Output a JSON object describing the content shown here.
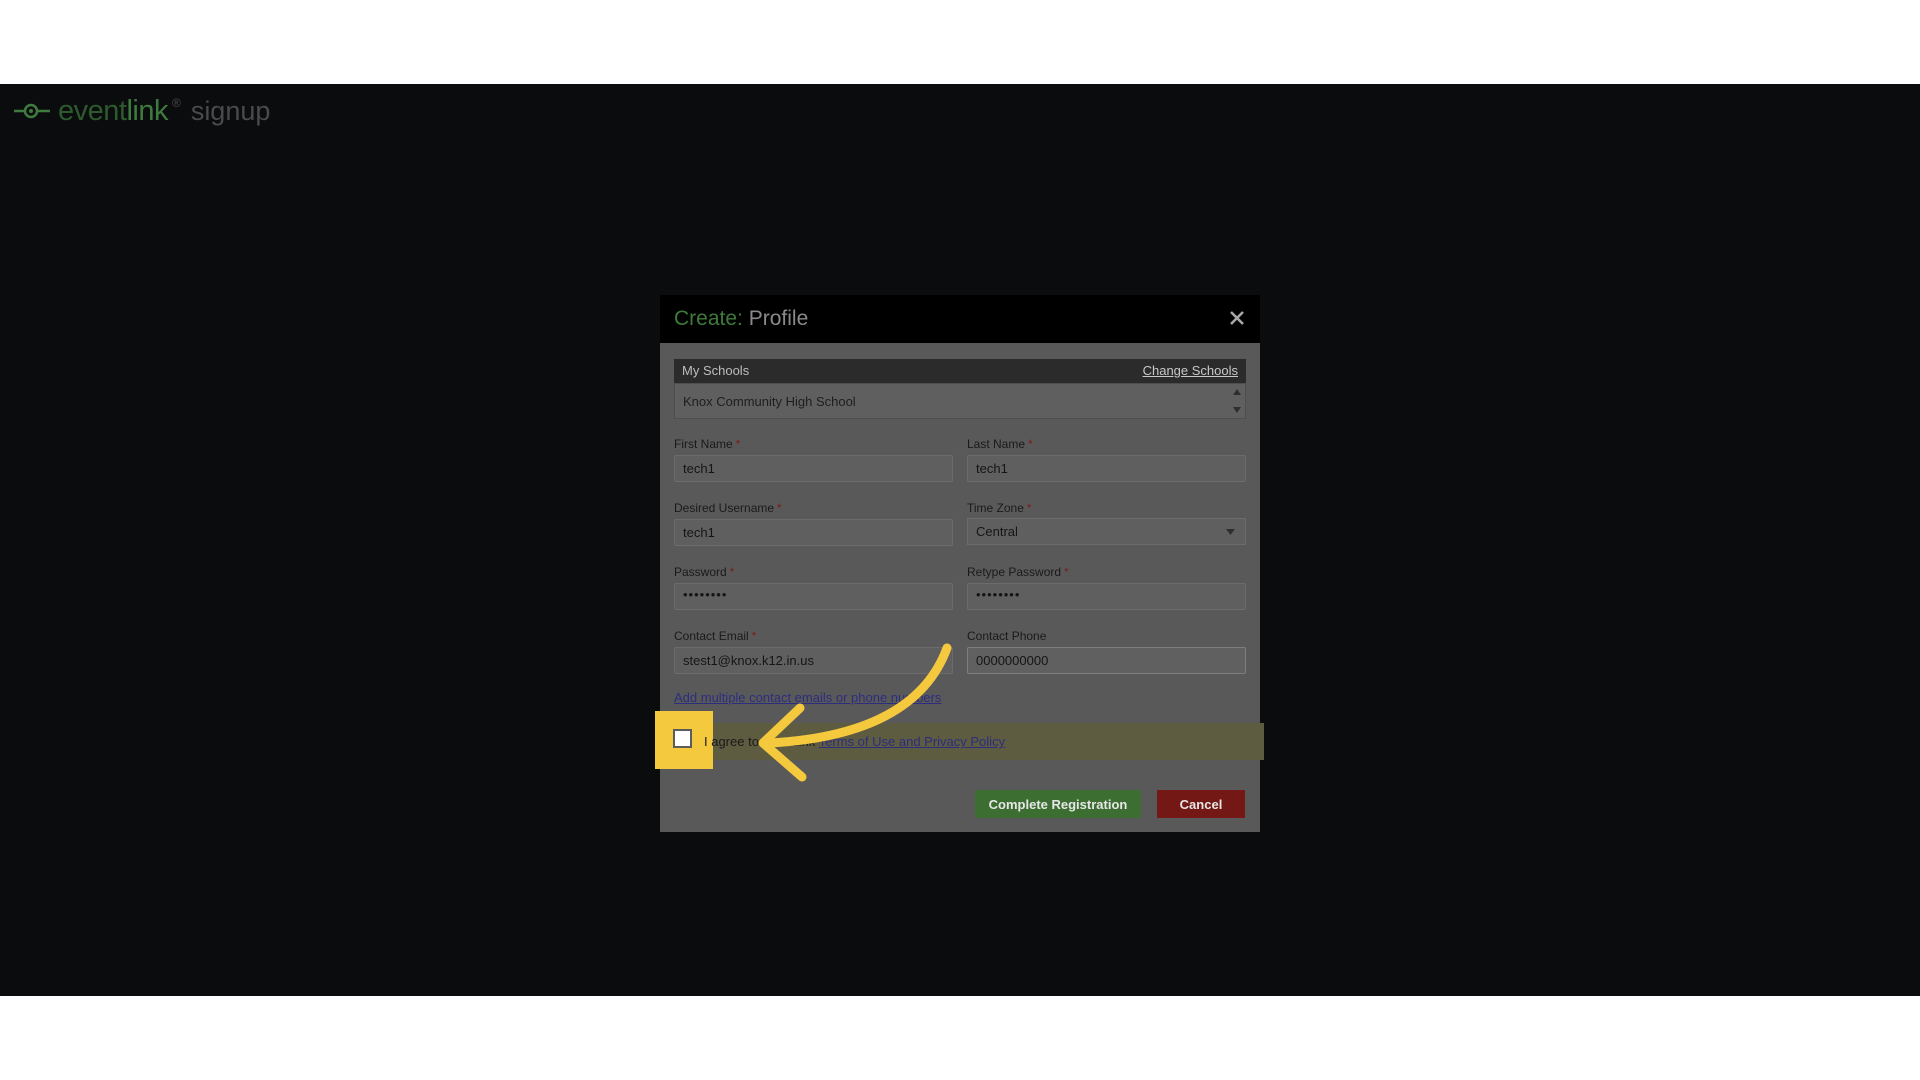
{
  "logo": {
    "brand_part1": "event",
    "brand_part2": "link",
    "trademark": "®",
    "suffix": "signup"
  },
  "modal": {
    "title_prefix": "Create:",
    "title_main": "Profile",
    "close_glyph": "✕"
  },
  "schools": {
    "header": "My Schools",
    "change_link": "Change Schools",
    "items": [
      "Knox Community High School"
    ]
  },
  "form": {
    "first_name": {
      "label": "First Name",
      "required": "*",
      "value": "tech1"
    },
    "last_name": {
      "label": "Last Name",
      "required": "*",
      "value": "tech1"
    },
    "username": {
      "label": "Desired Username",
      "required": "*",
      "value": "tech1"
    },
    "time_zone": {
      "label": "Time Zone",
      "required": "*",
      "value": "Central"
    },
    "password": {
      "label": "Password",
      "required": "*",
      "value": "••••••••"
    },
    "retype_password": {
      "label": "Retype Password",
      "required": "*",
      "value": "••••••••"
    },
    "contact_email": {
      "label": "Contact Email",
      "required": "*",
      "value": "stest1@knox.k12.in.us"
    },
    "contact_phone": {
      "label": "Contact Phone",
      "value": "0000000000"
    }
  },
  "links": {
    "add_multiple": "Add multiple contact emails or phone numbers"
  },
  "agreement": {
    "prefix": "I agree to Eventlink ",
    "link": "Terms of Use and Privacy Policy",
    "checked": false
  },
  "buttons": {
    "complete": "Complete Registration",
    "cancel": "Cancel"
  },
  "colors": {
    "accent_green": "#3e7a3b",
    "complete_button": "#3c6e32",
    "cancel_button": "#731814",
    "highlight": "#f5c93e"
  },
  "icons": {
    "logo": "plug-connector-icon",
    "close": "close-icon",
    "scroll_up": "triangle-up-icon",
    "scroll_down": "triangle-down-icon",
    "dropdown": "chevron-down-icon",
    "annotation": "curved-arrow-icon"
  }
}
